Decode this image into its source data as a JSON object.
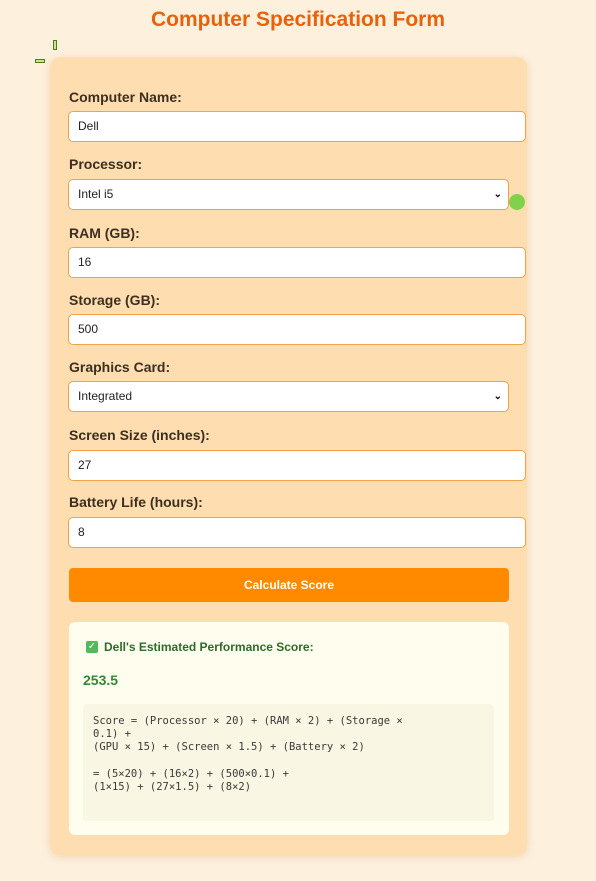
{
  "header": {
    "title": "Computer Specification Form"
  },
  "form": {
    "computer_name": {
      "label": "Computer Name:",
      "value": "Dell"
    },
    "processor": {
      "label": "Processor:",
      "value": "Intel i5"
    },
    "ram": {
      "label": "RAM (GB):",
      "value": "16"
    },
    "storage": {
      "label": "Storage (GB):",
      "value": "500"
    },
    "graphics": {
      "label": "Graphics Card:",
      "value": "Integrated"
    },
    "screen": {
      "label": "Screen Size (inches):",
      "value": "27"
    },
    "battery": {
      "label": "Battery Life (hours):",
      "value": "8"
    },
    "submit_label": "Calculate Score"
  },
  "result": {
    "icon": "checkmark-icon",
    "heading": "Dell's Estimated Performance Score:",
    "score": "253.5",
    "formula": [
      "Score = (Processor × 20) + (RAM × 2) + (Storage ×",
      "0.1) +",
      "(GPU × 15) + (Screen × 1.5) + (Battery × 2)",
      "= (5×20) + (16×2) + (500×0.1) +",
      "(1×15) + (27×1.5) + (8×2)"
    ]
  },
  "colors": {
    "accent": "#ff8a00",
    "title": "#e8620c",
    "card": "#fedeb0",
    "success": "#2f8a36"
  }
}
